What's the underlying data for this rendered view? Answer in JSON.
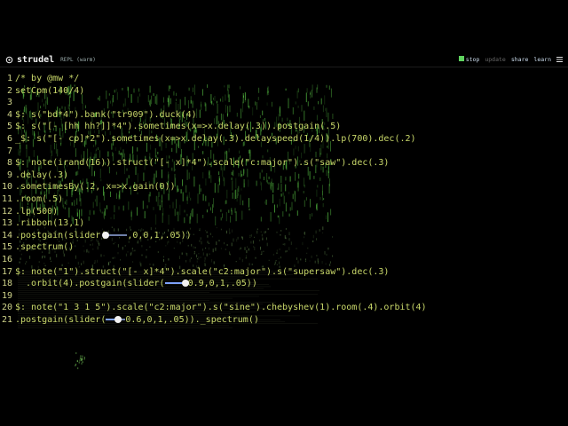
{
  "app": {
    "title": "strudel",
    "subtitle": "REPL (warm)",
    "nav": {
      "stop": "stop",
      "update": "update",
      "share": "share",
      "learn": "learn"
    },
    "colors": {
      "accent": "#5fd35f",
      "code": "#c9d86a",
      "bg": "#000000"
    }
  },
  "slider_values": {
    "line14": 0,
    "line18": 0.9,
    "line21": 0.6
  },
  "lines": [
    {
      "n": "1",
      "text": "/* by @mw */"
    },
    {
      "n": "2",
      "text": "setCpm(140/4)"
    },
    {
      "n": "3",
      "text": ""
    },
    {
      "n": "4",
      "text": "$: s(\"bd*4\").bank(\"tr909\").duck(4)"
    },
    {
      "n": "5",
      "text": "$: s(\"[- [hh hh?]]*4\").sometimes(x=>x.delay(.3)).postgain(.5)"
    },
    {
      "n": "6",
      "text": "_$: s(\"[- cp]*2\").sometimes(x=>x.delay(.3).delayspeed(1/4)).lp(700).dec(.2)"
    },
    {
      "n": "7",
      "text": ""
    },
    {
      "n": "8",
      "text": "$: note(irand(16)).struct(\"[- x]*4\").scale(\"c:major\").s(\"saw\").dec(.3)"
    },
    {
      "n": "9",
      "text": ".delay(.3)"
    },
    {
      "n": "10",
      "text": ".sometimesBy(.2, x=>x.gain(0))"
    },
    {
      "n": "11",
      "text": ".room(.5)"
    },
    {
      "n": "12",
      "text": ".lp(500)"
    },
    {
      "n": "13",
      "text": ".ribbon(13,1)"
    },
    {
      "n": "14",
      "text": ".postgain(slider(",
      "after": ",0,0,1,.05))"
    },
    {
      "n": "15",
      "text": ".spectrum()"
    },
    {
      "n": "16",
      "text": ""
    },
    {
      "n": "17",
      "text": "$: note(\"1\").struct(\"[- x]*4\").scale(\"c2:major\").s(\"supersaw\").dec(.3)"
    },
    {
      "n": "18",
      "text": "  .orbit(4).postgain(slider(",
      "after": "0.9,0,1,.05))"
    },
    {
      "n": "19",
      "text": ""
    },
    {
      "n": "20",
      "text": "$: note(\"1 3 1 5\").scale(\"c2:major\").s(\"sine\").chebyshev(1).room(.4).orbit(4)"
    },
    {
      "n": "21",
      "text": ".postgain(slider(",
      "after": "0.6,0,1,.05))._spectrum()"
    }
  ]
}
